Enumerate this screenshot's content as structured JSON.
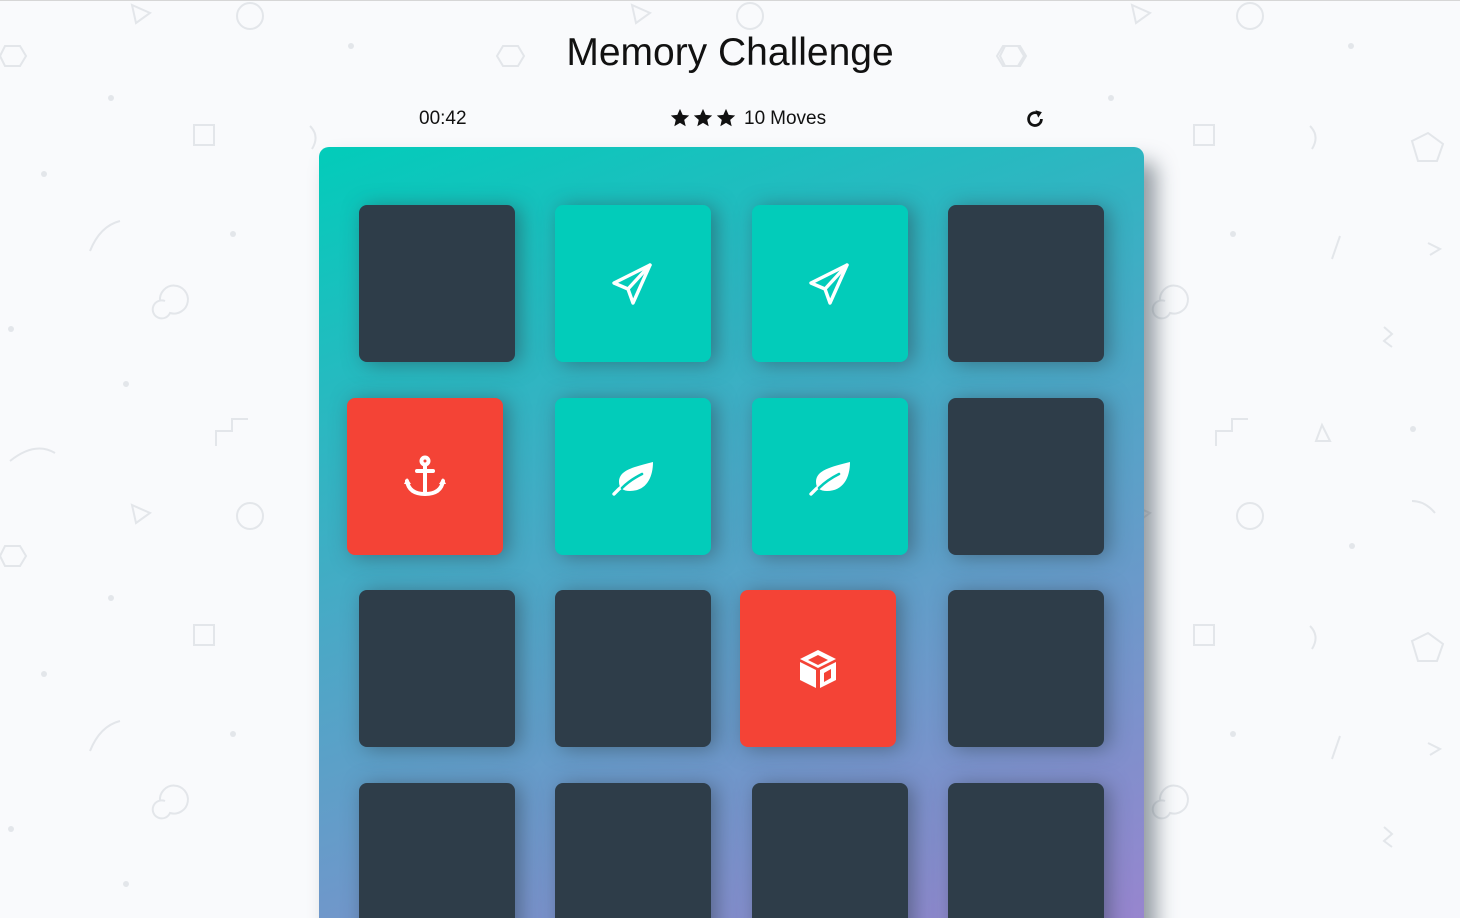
{
  "game": {
    "title": "Memory Challenge",
    "timer": "00:42",
    "star_rating": 3,
    "moves_count": "10",
    "moves_label": "Moves"
  },
  "deck": {
    "rows": [
      [
        {
          "state": "closed",
          "icon": ""
        },
        {
          "state": "match",
          "icon": "paper-plane-icon"
        },
        {
          "state": "match",
          "icon": "paper-plane-icon"
        },
        {
          "state": "closed",
          "icon": ""
        }
      ],
      [
        {
          "state": "open",
          "icon": "anchor-icon"
        },
        {
          "state": "match",
          "icon": "leaf-icon"
        },
        {
          "state": "match",
          "icon": "leaf-icon"
        },
        {
          "state": "closed",
          "icon": ""
        }
      ],
      [
        {
          "state": "closed",
          "icon": ""
        },
        {
          "state": "closed",
          "icon": ""
        },
        {
          "state": "open",
          "icon": "cube-icon"
        },
        {
          "state": "closed",
          "icon": ""
        }
      ],
      [
        {
          "state": "closed",
          "icon": ""
        },
        {
          "state": "closed",
          "icon": ""
        },
        {
          "state": "closed",
          "icon": ""
        },
        {
          "state": "closed",
          "icon": ""
        }
      ]
    ]
  },
  "colors": {
    "card_closed": "#2e3d49",
    "card_match": "#02ccba",
    "card_open": "#f44336",
    "deck_gradient_start": "#02ccba",
    "deck_gradient_end": "#aa7ecd"
  }
}
